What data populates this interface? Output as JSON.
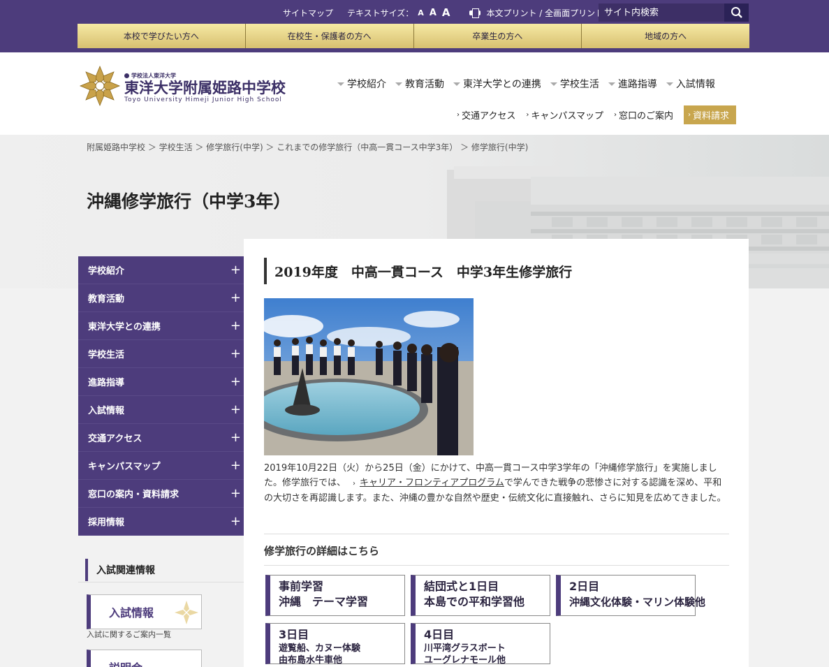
{
  "util": {
    "sitemap": "サイトマップ",
    "textsize_label": "テキストサイズ：",
    "textsize_small": "A",
    "textsize_medium": "A",
    "textsize_large": "A",
    "print": "本文プリント / 全画面プリント",
    "search_placeholder": "サイト内検索"
  },
  "topnav": [
    "本校で学びたい方へ",
    "在校生・保護者の方へ",
    "卒業生の方へ",
    "地域の方へ"
  ],
  "logo": {
    "corp": "学校法人東洋大学",
    "name": "東洋大学附属姫路中学校",
    "en": "Toyo University Himeji Junior High School"
  },
  "gnav": [
    "学校紹介",
    "教育活動",
    "東洋大学との連携",
    "学校生活",
    "進路指導",
    "入試情報"
  ],
  "subnav": {
    "access": "交通アクセス",
    "campus": "キャンパスマップ",
    "contact": "窓口のご案内",
    "request": "資料請求"
  },
  "breadcrumb": "附属姫路中学校 ＞ 学校生活 ＞ 修学旅行(中学) ＞ これまでの修学旅行（中高一貫コース中学3年） ＞ 修学旅行(中学)",
  "page_title": "沖縄修学旅行（中学3年）",
  "sidebar": {
    "items": [
      "学校紹介",
      "教育活動",
      "東洋大学との連携",
      "学校生活",
      "進路指導",
      "入試情報",
      "交通アクセス",
      "キャンパスマップ",
      "窓口の案内・資料請求",
      "採用情報"
    ],
    "related_title": "入試関連情報",
    "banner1": "入試情報",
    "banner1_caption": "入試に関するご案内一覧",
    "banner2": "説明会"
  },
  "article": {
    "title": "2019年度　中高一貫コース　中学3年生修学旅行",
    "text_before_link": "2019年10月22日（火）から25日（金）にかけて、中高一貫コース中学3学年の「沖縄修学旅行」を実施しました。修学旅行では、",
    "link": "キャリア・フロンティアプログラム",
    "text_after_link": "で学んできた戦争の悲惨さに対する認識を深め、平和の大切さを再認識します。また、沖縄の豊かな自然や歴史・伝統文化に直接触れ、さらに知見を広めてきました。",
    "section_title": "修学旅行の詳細はこちら",
    "days": [
      {
        "line1": "事前学習",
        "line2": "沖縄　テーマ学習"
      },
      {
        "line1": "結団式と1日目",
        "line2": "本島での平和学習他"
      },
      {
        "line1": "2日目",
        "line2": "沖縄文化体験・マリン体験他"
      },
      {
        "line1": "3日目",
        "line2": "遊覧船、カヌー体験",
        "line3": "由布島水牛車他"
      },
      {
        "line1": "4日目",
        "line2": "川平湾グラスボート",
        "line3": "ユーグレナモール他"
      }
    ]
  },
  "colors": {
    "brand_purple": "#4d3c7c",
    "gold": "#c8a64e"
  }
}
